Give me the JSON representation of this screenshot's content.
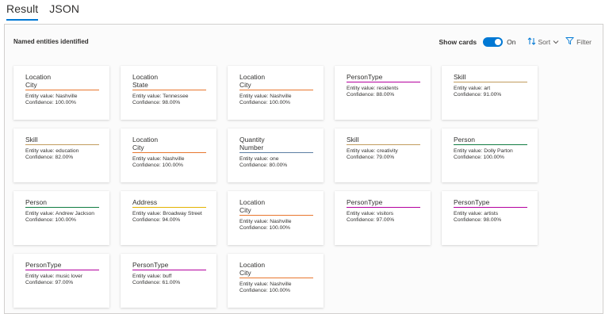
{
  "tabs": [
    {
      "label": "Result",
      "active": true
    },
    {
      "label": "JSON",
      "active": false
    }
  ],
  "panel": {
    "title": "Named entities identified",
    "show_cards_label": "Show cards",
    "toggle_state": "On",
    "sort_label": "Sort",
    "filter_label": "Filter"
  },
  "colors": {
    "accent": "#0078d4",
    "location": "#e8772e",
    "persontype": "#b4009e",
    "skill": "#c19c5d",
    "person": "#107c41",
    "quantity": "#5c7fa3",
    "address": "#e3b200"
  },
  "cards": [
    {
      "type": "Location",
      "subtype": "City",
      "value_line": "Entity value: Nashville",
      "confidence_line": "Confidence: 100.00%",
      "color": "#e8772e"
    },
    {
      "type": "Location",
      "subtype": "State",
      "value_line": "Entity value: Tennessee",
      "confidence_line": "Confidence: 98.00%",
      "color": "#e8772e"
    },
    {
      "type": "Location",
      "subtype": "City",
      "value_line": "Entity value: Nashville",
      "confidence_line": "Confidence: 100.00%",
      "color": "#e8772e"
    },
    {
      "type": "PersonType",
      "subtype": "",
      "value_line": "Entity value: residents",
      "confidence_line": "Confidence: 88.00%",
      "color": "#b4009e"
    },
    {
      "type": "Skill",
      "subtype": "",
      "value_line": "Entity value: art",
      "confidence_line": "Confidence: 91.00%",
      "color": "#c19c5d"
    },
    {
      "type": "Skill",
      "subtype": "",
      "value_line": "Entity value: education",
      "confidence_line": "Confidence: 82.00%",
      "color": "#c19c5d"
    },
    {
      "type": "Location",
      "subtype": "City",
      "value_line": "Entity value: Nashville",
      "confidence_line": "Confidence: 100.00%",
      "color": "#e8772e"
    },
    {
      "type": "Quantity",
      "subtype": "Number",
      "value_line": "Entity value: one",
      "confidence_line": "Confidence: 80.00%",
      "color": "#5c7fa3"
    },
    {
      "type": "Skill",
      "subtype": "",
      "value_line": "Entity value: creativity",
      "confidence_line": "Confidence: 79.00%",
      "color": "#c19c5d"
    },
    {
      "type": "Person",
      "subtype": "",
      "value_line": "Entity value: Dolly Parton",
      "confidence_line": "Confidence: 100.00%",
      "color": "#107c41"
    },
    {
      "type": "Person",
      "subtype": "",
      "value_line": "Entity value: Andrew Jackson",
      "confidence_line": "Confidence: 100.00%",
      "color": "#107c41"
    },
    {
      "type": "Address",
      "subtype": "",
      "value_line": "Entity value: Broadway Street",
      "confidence_line": "Confidence: 94.00%",
      "color": "#e3b200"
    },
    {
      "type": "Location",
      "subtype": "City",
      "value_line": "Entity value: Nashville",
      "confidence_line": "Confidence: 100.00%",
      "color": "#e8772e"
    },
    {
      "type": "PersonType",
      "subtype": "",
      "value_line": "Entity value: visitors",
      "confidence_line": "Confidence: 97.00%",
      "color": "#b4009e"
    },
    {
      "type": "PersonType",
      "subtype": "",
      "value_line": "Entity value: artists",
      "confidence_line": "Confidence: 98.00%",
      "color": "#b4009e"
    },
    {
      "type": "PersonType",
      "subtype": "",
      "value_line": "Entity value: music lover",
      "confidence_line": "Confidence: 97.00%",
      "color": "#b4009e"
    },
    {
      "type": "PersonType",
      "subtype": "",
      "value_line": "Entity value: buff",
      "confidence_line": "Confidence: 61.00%",
      "color": "#b4009e"
    },
    {
      "type": "Location",
      "subtype": "City",
      "value_line": "Entity value: Nashville",
      "confidence_line": "Confidence: 100.00%",
      "color": "#e8772e"
    }
  ]
}
